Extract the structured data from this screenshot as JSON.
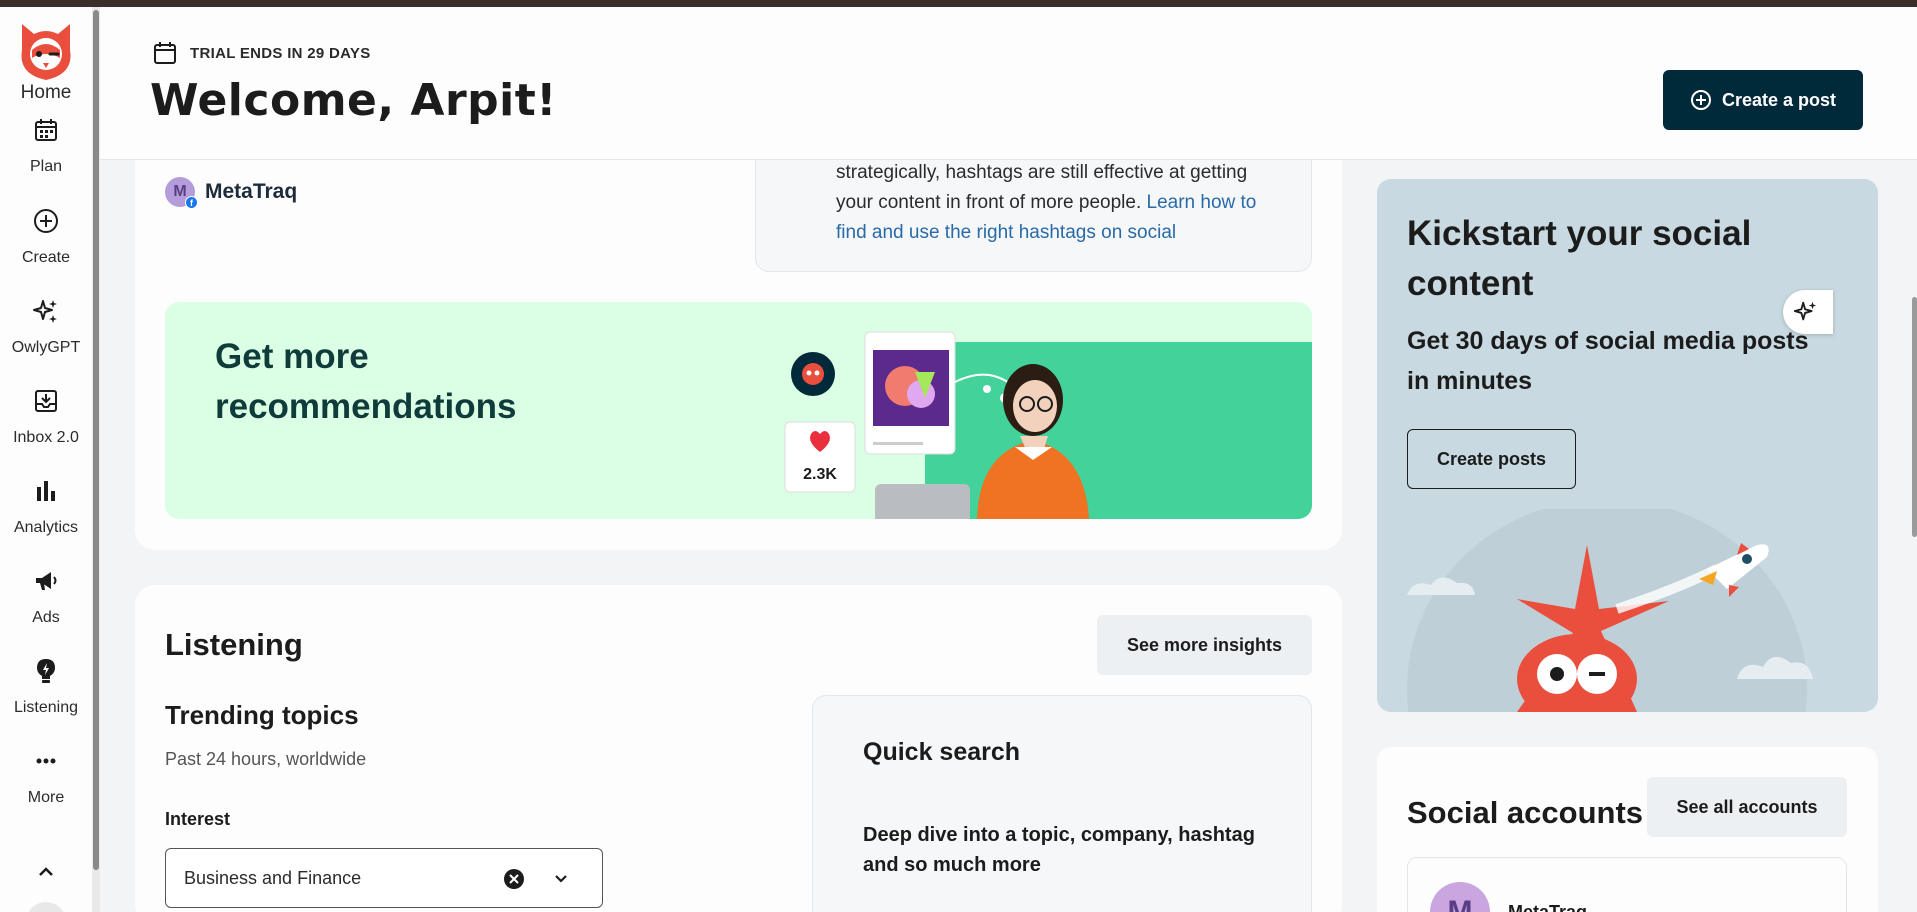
{
  "sidebar": {
    "logo": "owly-logo",
    "items": [
      {
        "label": "Home",
        "icon": "owl-home-icon"
      },
      {
        "label": "Plan",
        "icon": "calendar-icon"
      },
      {
        "label": "Create",
        "icon": "plus-circle-icon"
      },
      {
        "label": "OwlyGPT",
        "icon": "sparkles-icon"
      },
      {
        "label": "Inbox 2.0",
        "icon": "inbox-icon"
      },
      {
        "label": "Analytics",
        "icon": "bar-chart-icon"
      },
      {
        "label": "Ads",
        "icon": "megaphone-icon"
      },
      {
        "label": "Listening",
        "icon": "lightbulb-icon"
      },
      {
        "label": "More",
        "icon": "more-dots-icon"
      }
    ]
  },
  "header": {
    "trial_text": "TRIAL ENDS IN 29 DAYS",
    "welcome": "Welcome, Arpit!",
    "create_post": "Create a post"
  },
  "account": {
    "initial": "M",
    "name": "MetaTraq"
  },
  "tip": {
    "text": "strategically, hashtags are still effective at getting your content in front of more people. ",
    "link": "Learn how to find and use the right hashtags on social"
  },
  "recommendations": {
    "title": "Get more recommendations",
    "likes": "2.3K"
  },
  "listening": {
    "title": "Listening",
    "see_more": "See more insights",
    "trending_title": "Trending topics",
    "trending_sub": "Past 24 hours, worldwide",
    "interest_label": "Interest",
    "interest_value": "Business and Finance",
    "quick_title": "Quick search",
    "quick_desc": "Deep dive into a topic, company, hashtag and so much more"
  },
  "kickstart": {
    "title": "Kickstart your social content",
    "subtitle": "Get 30 days of social media posts in minutes",
    "button": "Create posts"
  },
  "social_accounts": {
    "title": "Social accounts",
    "see_all": "See all accounts",
    "first_initial": "M",
    "first_name": "MetaTraq"
  },
  "colors": {
    "brand_dark": "#002a3a",
    "owl_red": "#ea4f3d",
    "reco_bg": "#dbffe4",
    "reco_green": "#43d29a",
    "kick_bg": "#c8d9e1",
    "link": "#2a6aa8"
  }
}
